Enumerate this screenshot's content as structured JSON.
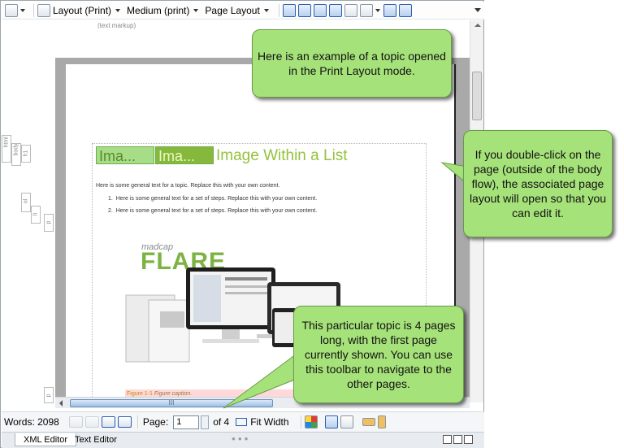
{
  "toolbar": {
    "layout_label": "Layout (Print)",
    "medium_label": "Medium (print)",
    "page_layout_label": "Page Layout"
  },
  "markup_label": "(text markup)",
  "structure_labels": [
    "html",
    "body",
    "h1",
    "ol",
    "li",
    "p",
    "p"
  ],
  "page": {
    "heading_chip_1": "Ima...",
    "heading_chip_2": "Ima...",
    "heading": "Image Within a List",
    "intro": "Here is some general text for a topic. Replace this with your own content.",
    "steps": [
      {
        "num": "1.",
        "text": "Here is some general text for a set of steps. Replace this with your own content."
      },
      {
        "num": "2.",
        "text": "Here is some general text for a set of steps. Replace this with your own content."
      }
    ],
    "image_madcap": "madcap",
    "image_flare": "FLARE",
    "caption_prefix": "Figure 1-1",
    "caption_text": "Figure caption."
  },
  "status": {
    "words_label": "Words: 2098",
    "page_label": "Page:",
    "page_value": "1",
    "of_label": "of 4",
    "fit_width_label": "Fit Width"
  },
  "tabs": {
    "xml_editor": "XML Editor",
    "text_editor": "Text Editor"
  },
  "callouts": {
    "print_layout": "Here is an example of a topic opened in the Print Layout mode.",
    "double_click": "If you double-click on the page (outside of the body flow), the associated page layout will open so that you can edit it.",
    "toolbar_pages": "This particular topic is 4 pages long, with the first page currently shown. You can use this toolbar to navigate to the other pages."
  },
  "colors": {
    "callout_fill": "#a6e27a",
    "heading_green": "#95c23d",
    "accent_blue": "#2a5fae"
  }
}
